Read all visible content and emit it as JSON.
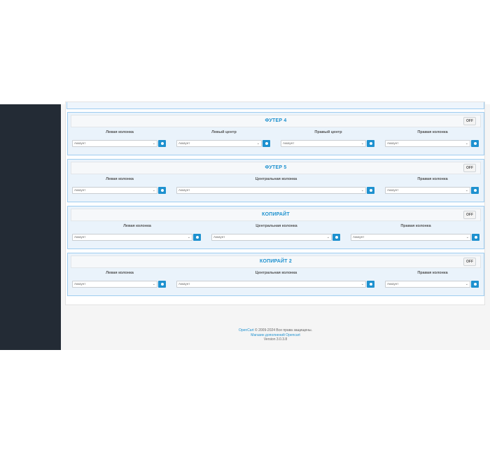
{
  "sections": [
    {
      "title": "ФУТЕР 4",
      "toggle": "OFF",
      "columns": [
        {
          "label": "Левая колонка",
          "value": "Аккаунт"
        },
        {
          "label": "Левый центр",
          "value": "Аккаунт"
        },
        {
          "label": "Правый центр",
          "value": "Аккаунт"
        },
        {
          "label": "Правая колонка",
          "value": "Аккаунт"
        }
      ]
    },
    {
      "title": "ФУТЕР 5",
      "toggle": "OFF",
      "columns": [
        {
          "label": "Левая колонка",
          "value": "Аккаунт"
        },
        {
          "label": "Центральная колонка",
          "value": "Аккаунт"
        },
        {
          "label": "Правая колонка",
          "value": "Аккаунт"
        }
      ]
    },
    {
      "title": "КОПИРАЙТ",
      "toggle": "OFF",
      "columns": [
        {
          "label": "Левая колонка",
          "value": "Аккаунт"
        },
        {
          "label": "Центральная колонка",
          "value": "Аккаунт"
        },
        {
          "label": "Правая колонка",
          "value": "Аккаунт"
        }
      ]
    },
    {
      "title": "КОПИРАЙТ 2",
      "toggle": "OFF",
      "columns": [
        {
          "label": "Левая колонка",
          "value": "Аккаунт"
        },
        {
          "label": "Центральная колонка",
          "value": "Аккаунт"
        },
        {
          "label": "Правая колонка",
          "value": "Аккаунт"
        }
      ]
    }
  ],
  "footer": {
    "brand_link": "OpenCart",
    "copyright": " © 2009-2024 Все права защищены.",
    "store_link": "Магазин дополнений Opencart",
    "version": "Version 3.0.3.8"
  },
  "colors": {
    "accent": "#1e91cf",
    "sidebar": "#232b35",
    "section_border": "#9fcdf0",
    "section_bg": "#eaf3fb"
  },
  "icons": {
    "select_arrow": "chevron-down-icon",
    "add_button": "plus-circle-icon"
  }
}
